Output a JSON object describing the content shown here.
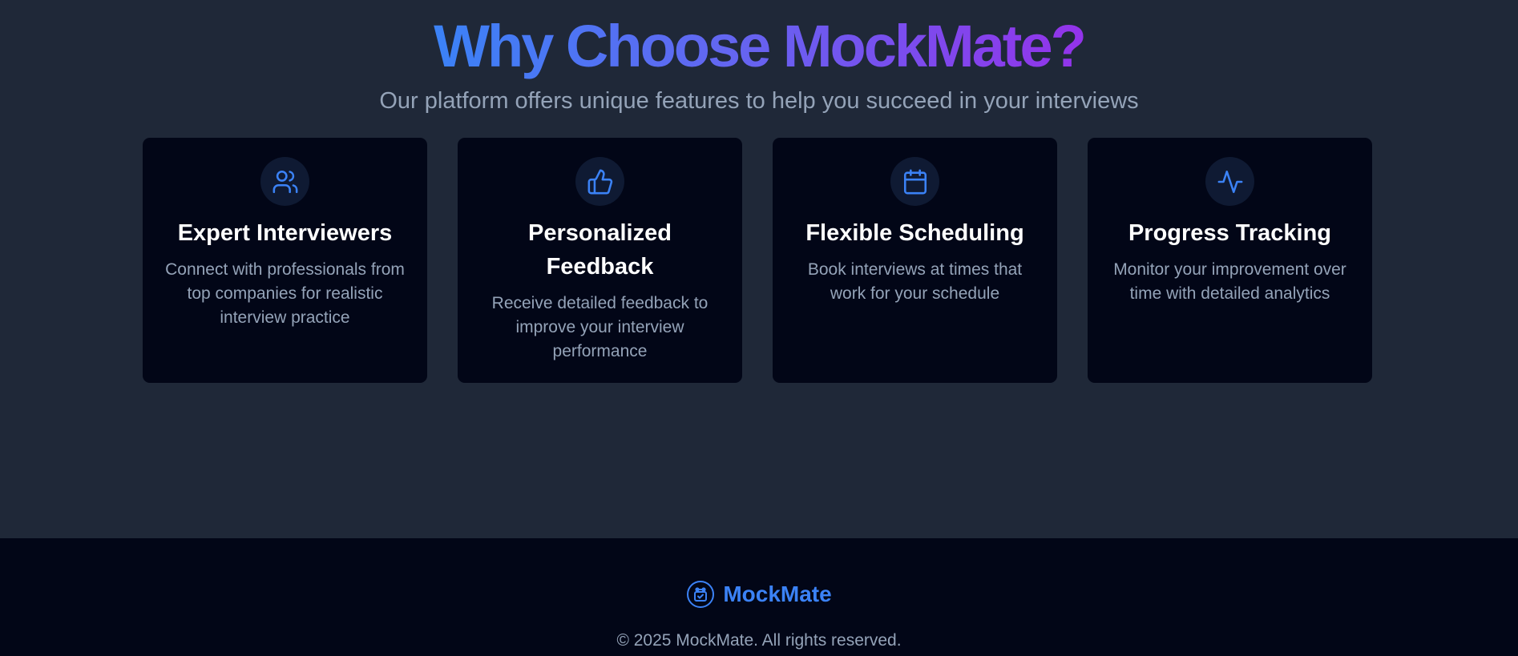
{
  "header": {
    "title": "Why Choose MockMate?",
    "subtitle": "Our platform offers unique features to help you succeed in your interviews"
  },
  "features": [
    {
      "icon": "users-icon",
      "title": "Expert Interviewers",
      "description": "Connect with professionals from top companies for realistic interview practice"
    },
    {
      "icon": "thumbs-up-icon",
      "title": "Personalized Feedback",
      "description": "Receive detailed feedback to improve your interview performance"
    },
    {
      "icon": "calendar-icon",
      "title": "Flexible Scheduling",
      "description": "Book interviews at times that work for your schedule"
    },
    {
      "icon": "activity-icon",
      "title": "Progress Tracking",
      "description": "Monitor your improvement over time with detailed analytics"
    }
  ],
  "footer": {
    "brand_icon": "robot-icon",
    "brand_name": "MockMate",
    "copyright": "© 2025 MockMate. All rights reserved."
  },
  "colors": {
    "background": "#1f2838",
    "card": "#020617",
    "accent": "#3b82f6",
    "gradient_end": "#9333ea",
    "muted_text": "#94a3b8"
  }
}
